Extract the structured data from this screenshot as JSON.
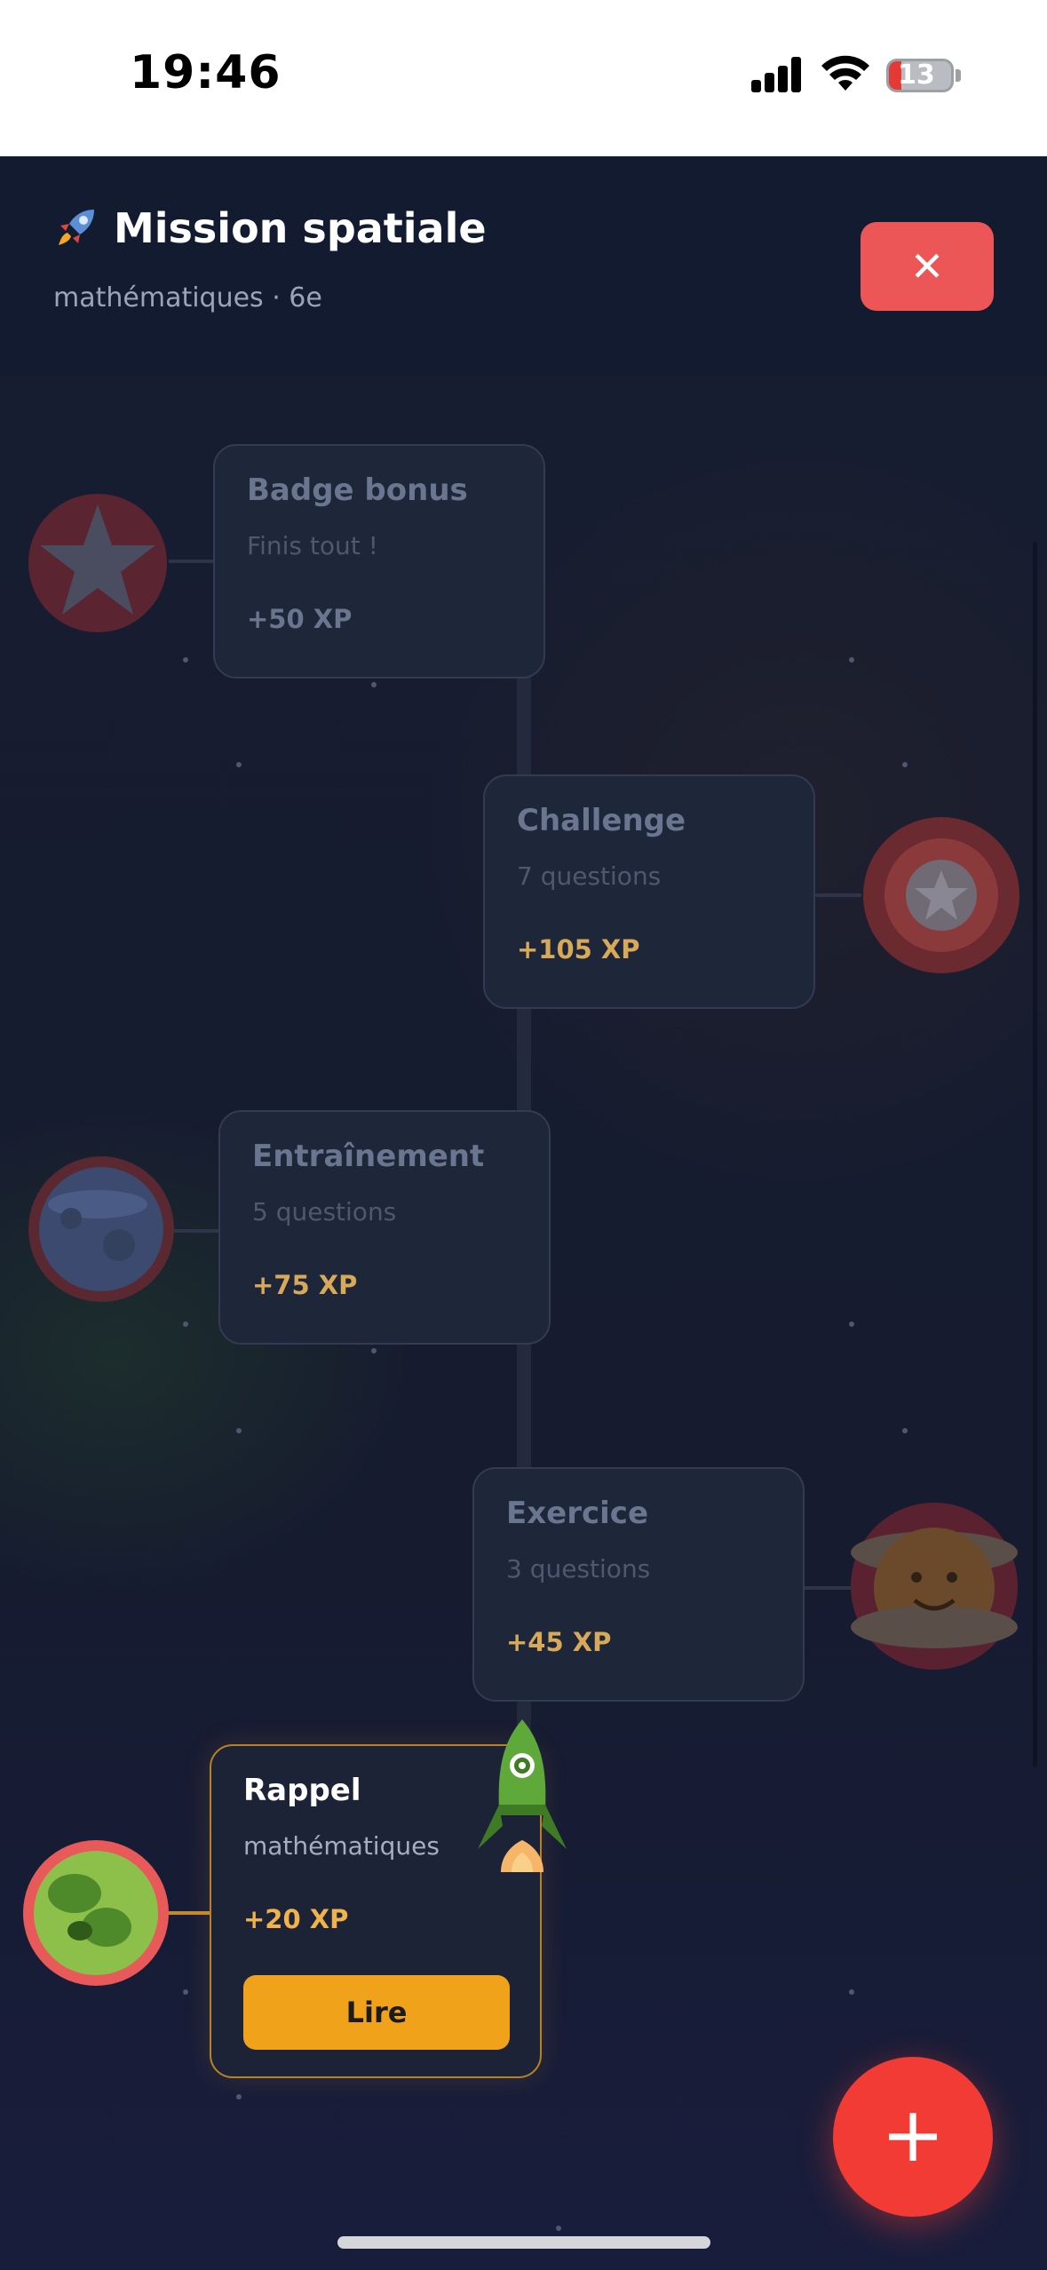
{
  "status_bar": {
    "time": "19:46",
    "battery": "13"
  },
  "header": {
    "title": "Mission spatiale",
    "subtitle": "mathématiques · 6e",
    "close_label": "✕"
  },
  "nodes": [
    {
      "title": "Badge bonus",
      "subtitle": "Finis tout !",
      "xp": "+50 XP",
      "planet_icon": "star-planet"
    },
    {
      "title": "Challenge",
      "subtitle": "7 questions",
      "xp": "+105 XP",
      "planet_icon": "star-planet"
    },
    {
      "title": "Entraînement",
      "subtitle": "5 questions",
      "xp": "+75 XP",
      "planet_icon": "blue-planet"
    },
    {
      "title": "Exercice",
      "subtitle": "3 questions",
      "xp": "+45 XP",
      "planet_icon": "ringed-face-planet"
    },
    {
      "title": "Rappel",
      "subtitle": "mathématiques",
      "xp": "+20 XP",
      "button": "Lire",
      "planet_icon": "green-planet",
      "active": true
    }
  ],
  "fab": {
    "label": "+"
  },
  "colors": {
    "accent": "#f1a21b",
    "close": "#ec5656",
    "fab": "#f23b34",
    "background": "#141a2e"
  }
}
